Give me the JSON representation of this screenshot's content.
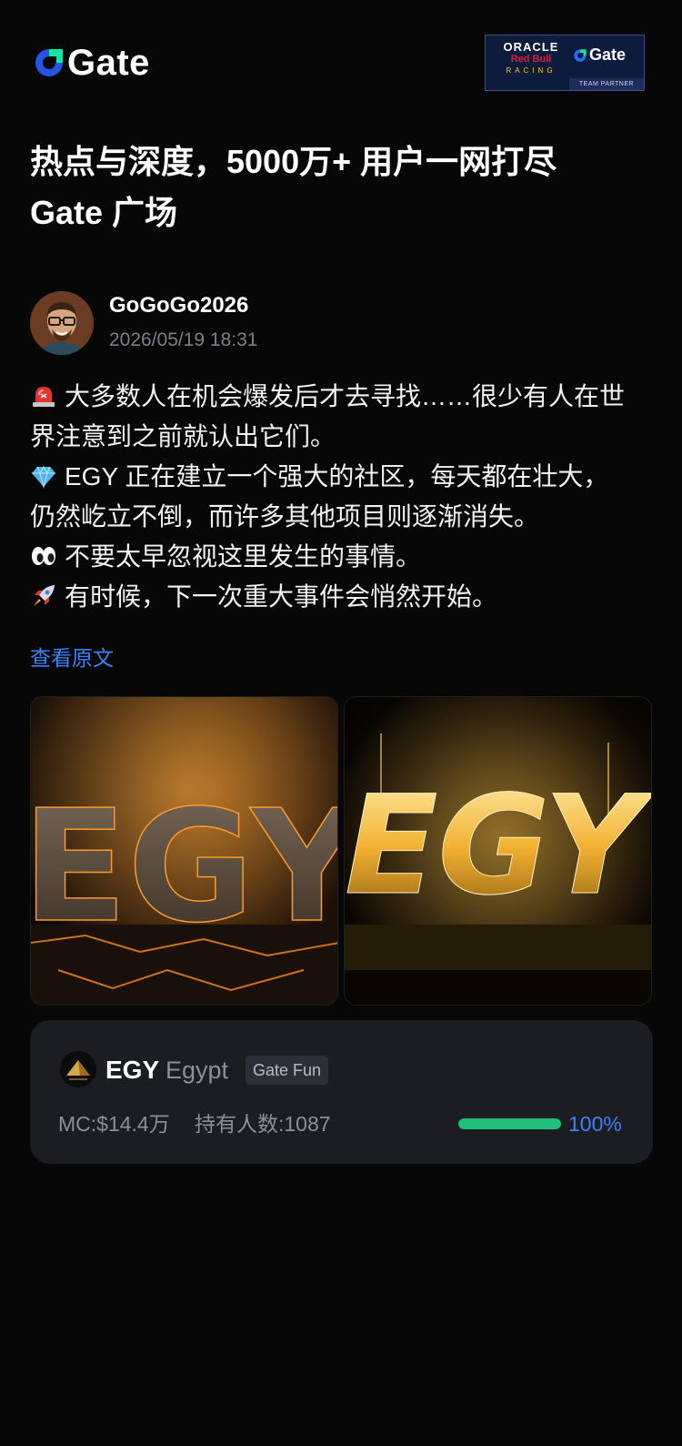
{
  "header": {
    "brand": "Gate",
    "partner": {
      "oracle": "ORACLE",
      "redbull": "Red Bull",
      "racing": "RACING",
      "gate": "Gate",
      "team": "TEAM PARTNER"
    }
  },
  "headline": {
    "line1": "热点与深度，5000万+ 用户一网打尽",
    "line2": "Gate 广场"
  },
  "post": {
    "author": "GoGoGo2026",
    "time": "2026/05/19 18:31",
    "lines": [
      {
        "icon": "siren-icon",
        "text": "大多数人在机会爆发后才去寻找……很少有人在世"
      },
      {
        "icon": "",
        "text": "界注意到之前就认出它们。"
      },
      {
        "icon": "gem-icon",
        "text": "EGY 正在建立一个强大的社区，每天都在壮大，"
      },
      {
        "icon": "",
        "text": "仍然屹立不倒，而许多其他项目则逐渐消失。"
      },
      {
        "icon": "eyes-icon",
        "text": "不要太早忽视这里发生的事情。"
      },
      {
        "icon": "rocket-icon",
        "text": "有时候，下一次重大事件会悄然开始。"
      }
    ],
    "view_original": "查看原文",
    "images": [
      {
        "text": "EGY",
        "style": "stone"
      },
      {
        "text": "EGY",
        "style": "gold"
      }
    ]
  },
  "token": {
    "symbol": "EGY",
    "name": "Egypt",
    "tag": "Gate Fun",
    "market_cap": "MC:$14.4万",
    "holders": "持有人数:1087",
    "progress": 100,
    "progress_label": "100%",
    "progress_color": "#20c07a"
  }
}
